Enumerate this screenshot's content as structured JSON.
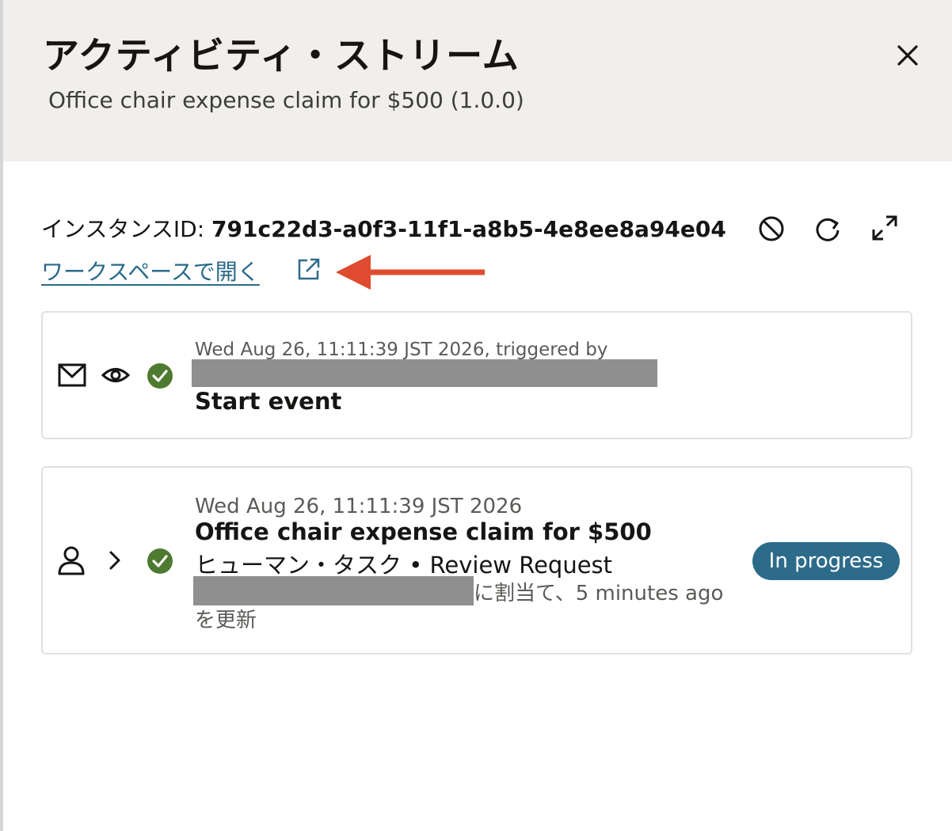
{
  "dialog": {
    "title": "アクティビティ・ストリーム",
    "subtitle": "Office chair expense claim for $500 (1.0.0)",
    "close_icon": "close-icon"
  },
  "instance": {
    "label": "インスタンスID: ",
    "id": "791c22d3-a0f3-11f1-a8b5-4e8ee8a94e04",
    "actions": [
      "cancel-icon",
      "refresh-icon",
      "expand-icon"
    ],
    "open_link": "ワークスペースで開く",
    "open_link_icon": "external-link-icon"
  },
  "annotation": {
    "arrow_color": "#e04a2f",
    "icon": "arrow-left-icon"
  },
  "events": [
    {
      "icons": [
        "envelope-icon",
        "eye-icon",
        "check-circle-icon"
      ],
      "timestamp": "Wed Aug 26, 11:11:39 JST 2026, triggered by",
      "title": "Start event"
    },
    {
      "icons": [
        "person-icon",
        "chevron-right-icon",
        "check-circle-icon"
      ],
      "timestamp": "Wed Aug 26, 11:11:39 JST 2026",
      "title": "Office chair expense claim for $500",
      "type_line": "ヒューマン・タスク • Review Request",
      "assigned_text": "に割当て、5 minutes ago",
      "updated_text": "を更新",
      "status": "In progress"
    }
  ],
  "colors": {
    "header_bg": "#f1efed",
    "check": "#4e7a31",
    "badge": "#2d6b8a",
    "link": "#2a6a8a"
  }
}
